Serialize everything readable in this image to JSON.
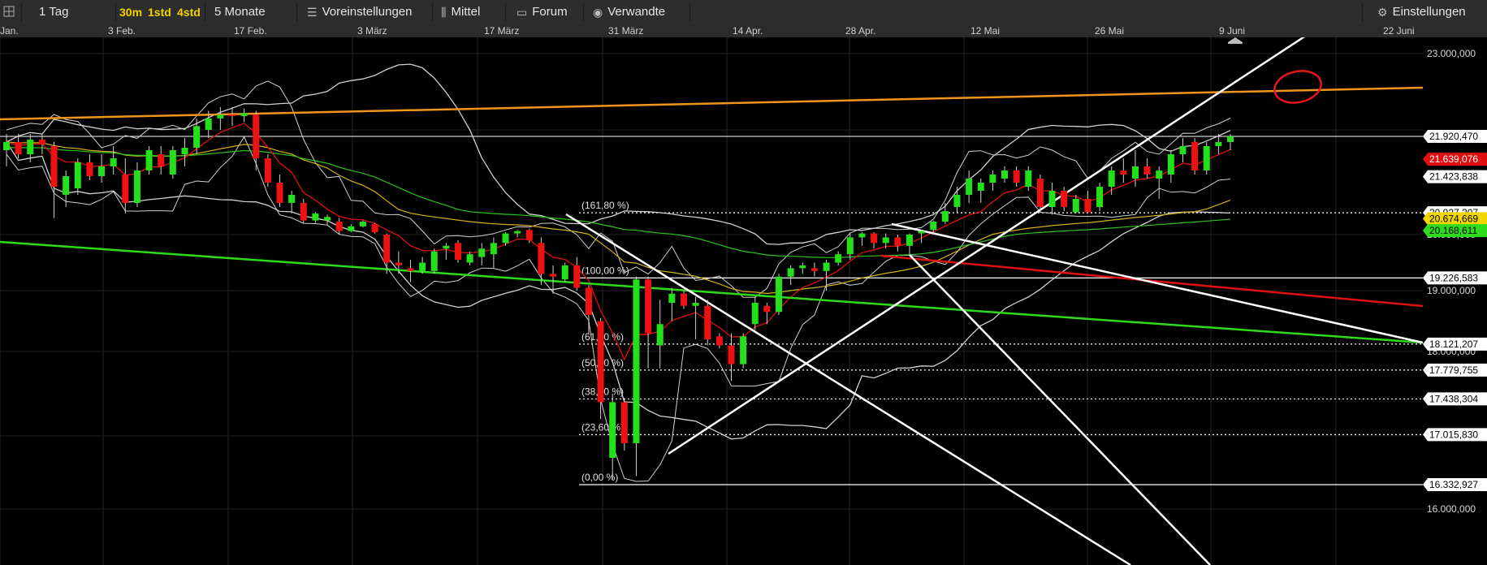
{
  "toolbar": {
    "interval": "1 Tag",
    "btn_30m": "30m",
    "btn_1std": "1std",
    "btn_4std": "4std",
    "range": "5 Monate",
    "presets": "Voreinstellungen",
    "average": "Mittel",
    "forum": "Forum",
    "related": "Verwandte",
    "settings": "Einstellungen"
  },
  "chart_data": {
    "type": "candlestick",
    "x_tick_labels": [
      "Jan.",
      "3 Feb.",
      "17 Feb.",
      "3 März",
      "17 März",
      "31 März",
      "14 Apr.",
      "28 Apr.",
      "12 Mai",
      "26 Mai",
      "9 Juni",
      "22 Juni"
    ],
    "y_tick_labels": [
      "23.000,000",
      "20.000,000",
      "19.000,000",
      "18.000,000",
      "16.000,000"
    ],
    "y_ticks": [
      23000000,
      20000000,
      19000000,
      18000000,
      16000000
    ],
    "fib_levels": [
      {
        "label": "(161,80 %)",
        "price": 20927207
      },
      {
        "label": "(100,00 %)",
        "price": 19226583
      },
      {
        "label": "(61,80 %)",
        "price": 18121207
      },
      {
        "label": "(50,00 %)",
        "price": 17779755
      },
      {
        "label": "(38,20 %)",
        "price": 17438304
      },
      {
        "label": "(23,60 %)",
        "price": 17015830
      },
      {
        "label": "(0,00 %)",
        "price": 16332927
      }
    ],
    "price_flags": [
      {
        "label": "21.920,470",
        "price": 21920470,
        "bg": "#ffffff",
        "fg": "#000000"
      },
      {
        "label": "21.639,076",
        "price": 21639076,
        "bg": "#e01010",
        "fg": "#ffffff"
      },
      {
        "label": "21.423,838",
        "price": 21423838,
        "bg": "#ffffff",
        "fg": "#000000"
      },
      {
        "label": "20.927,207",
        "price": 20927207,
        "bg": "#ffffff",
        "fg": "#000000"
      },
      {
        "label": "20.674,669",
        "price": 20674669,
        "bg": "#f2d600",
        "fg": "#000000"
      },
      {
        "label": "20.168,611",
        "price": 20168611,
        "bg": "#2edb1f",
        "fg": "#000000"
      },
      {
        "label": "19.226,583",
        "price": 19226583,
        "bg": "#ffffff",
        "fg": "#000000"
      },
      {
        "label": "18.121,207",
        "price": 18121207,
        "bg": "#ffffff",
        "fg": "#000000"
      },
      {
        "label": "17.779,755",
        "price": 17779755,
        "bg": "#ffffff",
        "fg": "#000000"
      },
      {
        "label": "17.438,304",
        "price": 17438304,
        "bg": "#ffffff",
        "fg": "#000000"
      },
      {
        "label": "17.015,830",
        "price": 17015830,
        "bg": "#ffffff",
        "fg": "#000000"
      },
      {
        "label": "16.332,927",
        "price": 16332927,
        "bg": "#ffffff",
        "fg": "#000000"
      }
    ],
    "colors": {
      "up": "#22e01a",
      "down": "#ee1111",
      "orange": "#f0941e",
      "bands": "#d0d0d0",
      "ma_red": "#e01010",
      "ma_yellow": "#d4b21a",
      "ma_green": "#2cc21a"
    },
    "candles": [
      {
        "o": 21750000,
        "h": 21950000,
        "l": 21550000,
        "c": 21850000
      },
      {
        "o": 21850000,
        "h": 21950000,
        "l": 21650000,
        "c": 21700000
      },
      {
        "o": 21700000,
        "h": 21950000,
        "l": 21600000,
        "c": 21880000
      },
      {
        "o": 21880000,
        "h": 21950000,
        "l": 21700000,
        "c": 21820000
      },
      {
        "o": 21800000,
        "h": 21850000,
        "l": 20700000,
        "c": 21300000
      },
      {
        "o": 21200000,
        "h": 21500000,
        "l": 21050000,
        "c": 21430000
      },
      {
        "o": 21280000,
        "h": 21650000,
        "l": 21200000,
        "c": 21600000
      },
      {
        "o": 21600000,
        "h": 21700000,
        "l": 21380000,
        "c": 21430000
      },
      {
        "o": 21430000,
        "h": 21700000,
        "l": 21350000,
        "c": 21550000
      },
      {
        "o": 21550000,
        "h": 21800000,
        "l": 21450000,
        "c": 21650000
      },
      {
        "o": 21450000,
        "h": 21650000,
        "l": 20900000,
        "c": 21100000
      },
      {
        "o": 21100000,
        "h": 21600000,
        "l": 21050000,
        "c": 21500000
      },
      {
        "o": 21500000,
        "h": 21800000,
        "l": 21450000,
        "c": 21750000
      },
      {
        "o": 21700000,
        "h": 21800000,
        "l": 21450000,
        "c": 21550000
      },
      {
        "o": 21450000,
        "h": 21800000,
        "l": 21400000,
        "c": 21750000
      },
      {
        "o": 21700000,
        "h": 21900000,
        "l": 21550000,
        "c": 21780000
      },
      {
        "o": 21780000,
        "h": 22150000,
        "l": 21700000,
        "c": 22050000
      },
      {
        "o": 22000000,
        "h": 22250000,
        "l": 21900000,
        "c": 22150000
      },
      {
        "o": 22150000,
        "h": 22300000,
        "l": 22000000,
        "c": 22200000
      },
      {
        "o": 22200000,
        "h": 22300000,
        "l": 22050000,
        "c": 22180000
      },
      {
        "o": 22180000,
        "h": 22280000,
        "l": 22100000,
        "c": 22220000
      },
      {
        "o": 22200000,
        "h": 22250000,
        "l": 21500000,
        "c": 21650000
      },
      {
        "o": 21650000,
        "h": 21700000,
        "l": 21300000,
        "c": 21350000
      },
      {
        "o": 21350000,
        "h": 21450000,
        "l": 21050000,
        "c": 21100000
      },
      {
        "o": 21100000,
        "h": 21250000,
        "l": 20900000,
        "c": 21200000
      },
      {
        "o": 21100000,
        "h": 21150000,
        "l": 20500000,
        "c": 20600000
      },
      {
        "o": 20600000,
        "h": 20950000,
        "l": 20500000,
        "c": 20900000
      },
      {
        "o": 20600000,
        "h": 20850000,
        "l": 20400000,
        "c": 20750000
      },
      {
        "o": 20550000,
        "h": 20700000,
        "l": 20000000,
        "c": 20150000
      },
      {
        "o": 20150000,
        "h": 20450000,
        "l": 20100000,
        "c": 20350000
      },
      {
        "o": 20350000,
        "h": 20600000,
        "l": 20300000,
        "c": 20550000
      },
      {
        "o": 20450000,
        "h": 20500000,
        "l": 20050000,
        "c": 20100000
      },
      {
        "o": 20000000,
        "h": 20050000,
        "l": 19300000,
        "c": 19500000
      },
      {
        "o": 19500000,
        "h": 19700000,
        "l": 19300000,
        "c": 19450000
      },
      {
        "o": 19400000,
        "h": 19550000,
        "l": 19150000,
        "c": 19350000
      },
      {
        "o": 19350000,
        "h": 19600000,
        "l": 19300000,
        "c": 19500000
      },
      {
        "o": 19350000,
        "h": 19750000,
        "l": 19300000,
        "c": 19700000
      },
      {
        "o": 19750000,
        "h": 19850000,
        "l": 19550000,
        "c": 19800000
      },
      {
        "o": 19850000,
        "h": 19900000,
        "l": 19500000,
        "c": 19550000
      },
      {
        "o": 19500000,
        "h": 19700000,
        "l": 19450000,
        "c": 19650000
      },
      {
        "o": 19600000,
        "h": 19850000,
        "l": 19450000,
        "c": 19750000
      },
      {
        "o": 19650000,
        "h": 19950000,
        "l": 19400000,
        "c": 19850000
      },
      {
        "o": 19850000,
        "h": 20100000,
        "l": 19800000,
        "c": 20050000
      },
      {
        "o": 20050000,
        "h": 20200000,
        "l": 19950000,
        "c": 20150000
      },
      {
        "o": 20200000,
        "h": 20250000,
        "l": 19850000,
        "c": 19900000
      },
      {
        "o": 19850000,
        "h": 19950000,
        "l": 19100000,
        "c": 19300000
      },
      {
        "o": 19300000,
        "h": 19450000,
        "l": 18950000,
        "c": 19250000
      },
      {
        "o": 19200000,
        "h": 19500000,
        "l": 19150000,
        "c": 19450000
      },
      {
        "o": 19450000,
        "h": 19600000,
        "l": 19000000,
        "c": 19050000
      },
      {
        "o": 19050000,
        "h": 19100000,
        "l": 18300000,
        "c": 18600000
      },
      {
        "o": 18500000,
        "h": 18550000,
        "l": 17200000,
        "c": 17400000
      },
      {
        "o": 16700000,
        "h": 17500000,
        "l": 16400000,
        "c": 17400000
      },
      {
        "o": 17400000,
        "h": 17450000,
        "l": 16800000,
        "c": 16900000
      },
      {
        "o": 16900000,
        "h": 19250000,
        "l": 16450000,
        "c": 19200000
      },
      {
        "o": 19200000,
        "h": 19250000,
        "l": 17800000,
        "c": 18300000
      },
      {
        "o": 18100000,
        "h": 18850000,
        "l": 17800000,
        "c": 18450000
      },
      {
        "o": 18800000,
        "h": 19050000,
        "l": 18500000,
        "c": 18950000
      },
      {
        "o": 18950000,
        "h": 19000000,
        "l": 18700000,
        "c": 18750000
      },
      {
        "o": 18750000,
        "h": 18900000,
        "l": 18200000,
        "c": 18800000
      },
      {
        "o": 18750000,
        "h": 18850000,
        "l": 18100000,
        "c": 18200000
      },
      {
        "o": 18250000,
        "h": 18300000,
        "l": 18050000,
        "c": 18100000
      },
      {
        "o": 18100000,
        "h": 18300000,
        "l": 17650000,
        "c": 17850000
      },
      {
        "o": 17850000,
        "h": 18300000,
        "l": 17800000,
        "c": 18250000
      },
      {
        "o": 18450000,
        "h": 18900000,
        "l": 18350000,
        "c": 18800000
      },
      {
        "o": 18750000,
        "h": 18800000,
        "l": 18450000,
        "c": 18650000
      },
      {
        "o": 18650000,
        "h": 19300000,
        "l": 18600000,
        "c": 19250000
      },
      {
        "o": 19250000,
        "h": 19450000,
        "l": 19100000,
        "c": 19400000
      },
      {
        "o": 19400000,
        "h": 19500000,
        "l": 19300000,
        "c": 19450000
      },
      {
        "o": 19400000,
        "h": 19500000,
        "l": 19250000,
        "c": 19350000
      },
      {
        "o": 19350000,
        "h": 19550000,
        "l": 19000000,
        "c": 19500000
      },
      {
        "o": 19500000,
        "h": 19700000,
        "l": 19450000,
        "c": 19650000
      },
      {
        "o": 19650000,
        "h": 20050000,
        "l": 19550000,
        "c": 19950000
      },
      {
        "o": 19950000,
        "h": 20100000,
        "l": 19800000,
        "c": 20050000
      },
      {
        "o": 20050000,
        "h": 20100000,
        "l": 19750000,
        "c": 19850000
      },
      {
        "o": 19850000,
        "h": 20050000,
        "l": 19750000,
        "c": 19950000
      },
      {
        "o": 19950000,
        "h": 20000000,
        "l": 19700000,
        "c": 19800000
      },
      {
        "o": 19800000,
        "h": 20050000,
        "l": 19650000,
        "c": 20000000
      },
      {
        "o": 20050000,
        "h": 20200000,
        "l": 19850000,
        "c": 20150000
      },
      {
        "o": 20200000,
        "h": 20600000,
        "l": 20000000,
        "c": 20550000
      },
      {
        "o": 20550000,
        "h": 21100000,
        "l": 20450000,
        "c": 21000000
      },
      {
        "o": 21050000,
        "h": 21300000,
        "l": 20950000,
        "c": 21200000
      },
      {
        "o": 21200000,
        "h": 21500000,
        "l": 21100000,
        "c": 21400000
      },
      {
        "o": 21250000,
        "h": 21400000,
        "l": 21100000,
        "c": 21350000
      },
      {
        "o": 21350000,
        "h": 21500000,
        "l": 21250000,
        "c": 21450000
      },
      {
        "o": 21400000,
        "h": 21550000,
        "l": 21350000,
        "c": 21500000
      },
      {
        "o": 21500000,
        "h": 21550000,
        "l": 21300000,
        "c": 21350000
      },
      {
        "o": 21300000,
        "h": 21550000,
        "l": 21250000,
        "c": 21500000
      },
      {
        "o": 21400000,
        "h": 21450000,
        "l": 20950000,
        "c": 21050000
      },
      {
        "o": 21050000,
        "h": 21350000,
        "l": 20850000,
        "c": 21250000
      },
      {
        "o": 21250000,
        "h": 21300000,
        "l": 21000000,
        "c": 21050000
      },
      {
        "o": 20950000,
        "h": 21200000,
        "l": 20900000,
        "c": 21150000
      },
      {
        "o": 21150000,
        "h": 21250000,
        "l": 20900000,
        "c": 20950000
      },
      {
        "o": 21050000,
        "h": 21350000,
        "l": 21000000,
        "c": 21300000
      },
      {
        "o": 21300000,
        "h": 21550000,
        "l": 21200000,
        "c": 21500000
      },
      {
        "o": 21500000,
        "h": 21650000,
        "l": 21350000,
        "c": 21450000
      },
      {
        "o": 21400000,
        "h": 21750000,
        "l": 21300000,
        "c": 21550000
      },
      {
        "o": 21550000,
        "h": 21650000,
        "l": 21400000,
        "c": 21450000
      },
      {
        "o": 21400000,
        "h": 21550000,
        "l": 21150000,
        "c": 21500000
      },
      {
        "o": 21450000,
        "h": 21750000,
        "l": 21350000,
        "c": 21700000
      },
      {
        "o": 21700000,
        "h": 21900000,
        "l": 21600000,
        "c": 21800000
      },
      {
        "o": 21850000,
        "h": 21900000,
        "l": 21450000,
        "c": 21500000
      },
      {
        "o": 21500000,
        "h": 21850000,
        "l": 21450000,
        "c": 21800000
      },
      {
        "o": 21800000,
        "h": 21950000,
        "l": 21700000,
        "c": 21850000
      },
      {
        "o": 21850000,
        "h": 21950000,
        "l": 21750000,
        "c": 21920000
      }
    ]
  }
}
